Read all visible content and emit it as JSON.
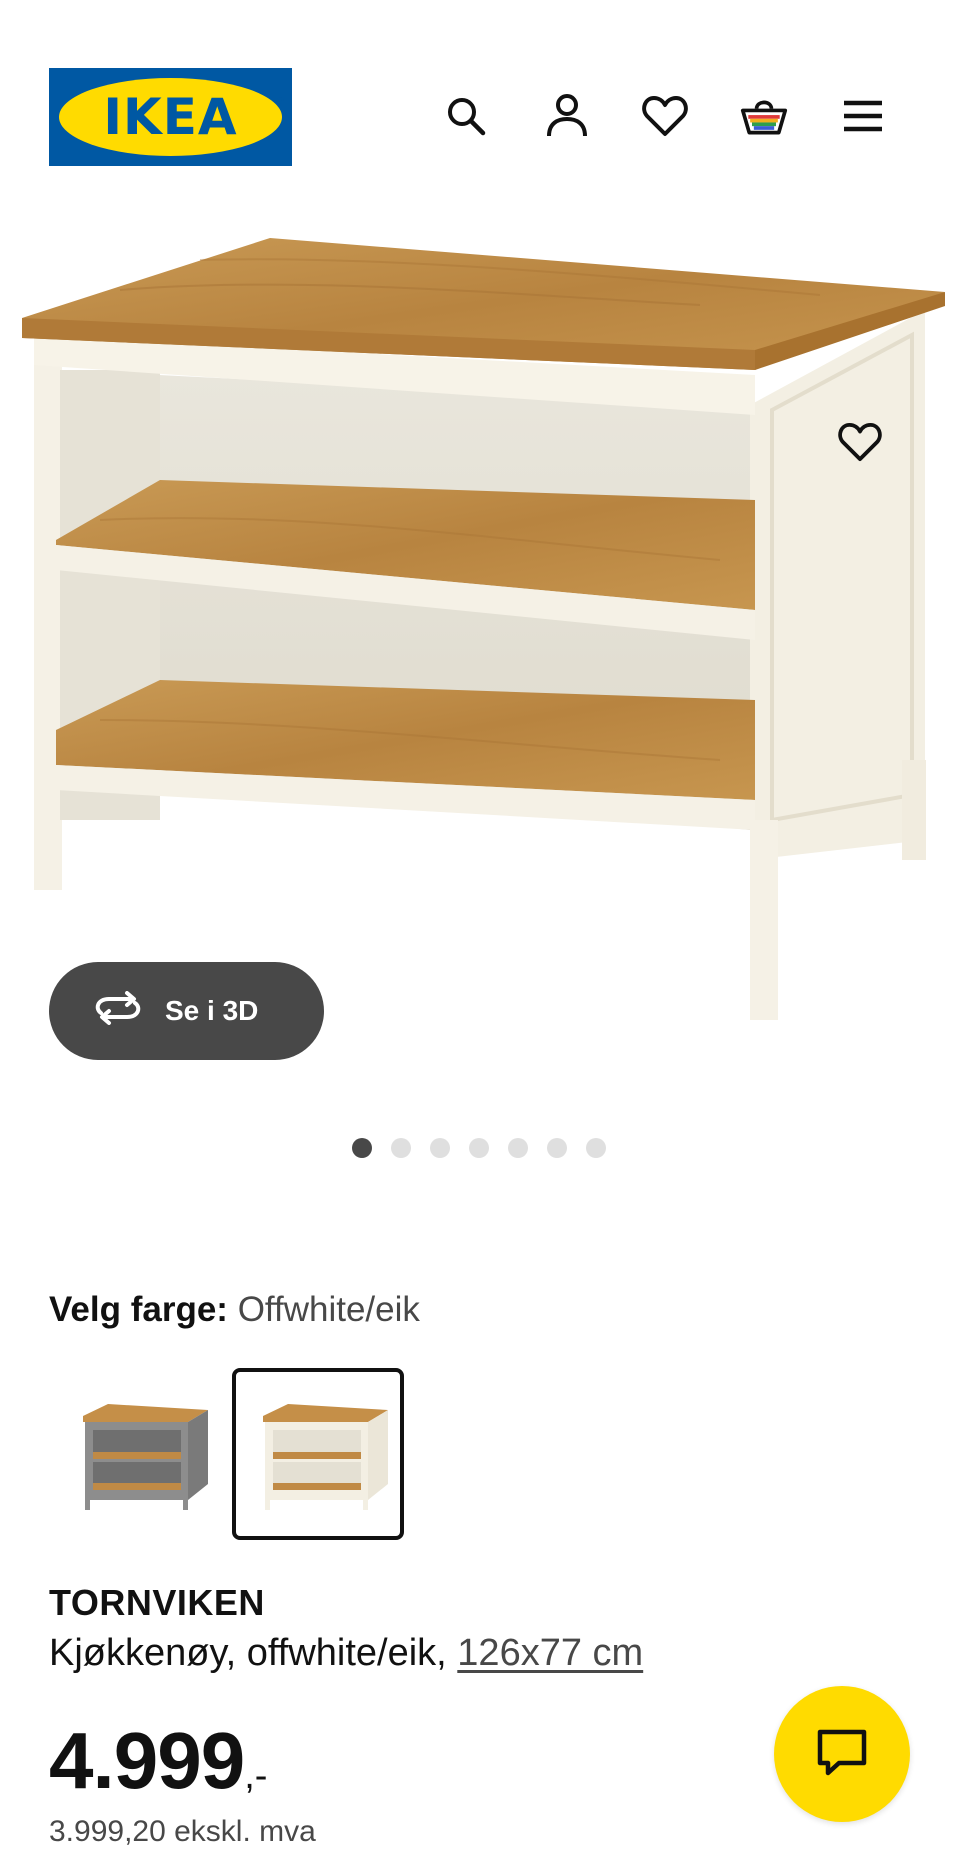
{
  "header": {
    "logo_text": "IKEA",
    "icons": [
      "search-icon",
      "account-icon",
      "wishlist-icon",
      "cart-icon",
      "menu-icon"
    ]
  },
  "gallery": {
    "view_3d_label": "Se i 3D",
    "slide_count": 7,
    "active_slide": 1
  },
  "color": {
    "label": "Velg farge:",
    "value": "Offwhite/eik",
    "options_count": 2,
    "selected_index": 1
  },
  "product": {
    "name": "TORNVIKEN",
    "description": "Kjøkkenøy, offwhite/eik, ",
    "dimensions": "126x77 cm",
    "price_main": "4.999",
    "price_suffix": ",-",
    "price_ex_vat": "3.999,20 ekskl. mva"
  },
  "colors": {
    "brand_blue": "#0058a3",
    "brand_yellow": "#ffdb00",
    "dark_grey": "#484848"
  }
}
